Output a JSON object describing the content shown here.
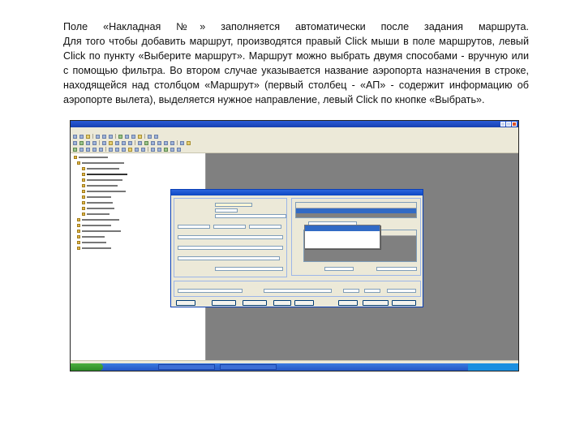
{
  "paragraph": {
    "lines": [
      "Поле «Накладная №» заполняется автоматически после задания маршрута.",
      "Для того чтобы добавить маршрут, производятся правый Click мыши в поле маршрутов, левый",
      "Click по пункту «Выберите маршрут». Маршрут можно выбрать двумя способами - вручную или",
      "с помощью фильтра. Во втором случае указывается название аэропорта назначения в строке,",
      "находящейся над столбцом «Маршрут» (первый столбец - «АП» - содержит информацию об",
      "аэропорте вылета), выделяется нужное направление, левый Click по кнопке «Выбрать»."
    ]
  },
  "screenshot": {
    "description_icon": "embedded-application-screenshot",
    "colors": {
      "titlebar": "#2a5bd7",
      "workspace": "#808080",
      "taskbar": "#2456c4",
      "selection": "#316ac5"
    }
  }
}
